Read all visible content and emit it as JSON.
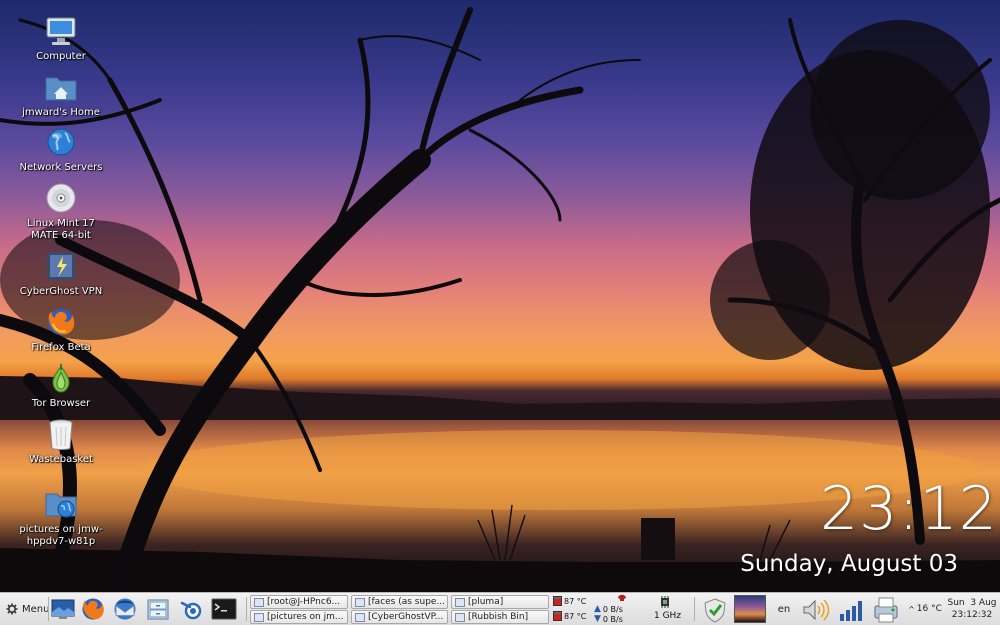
{
  "desktop": {
    "icons": [
      {
        "label": "Computer",
        "icon": "monitor-icon"
      },
      {
        "label": "jmward's Home",
        "icon": "home-folder-icon"
      },
      {
        "label": "Network Servers",
        "icon": "globe-icon"
      },
      {
        "label": "Linux Mint 17 MATE 64-bit",
        "icon": "disc-icon"
      },
      {
        "label": "CyberGhost VPN",
        "icon": "cyberghost-icon"
      },
      {
        "label": "Firefox Beta",
        "icon": "firefox-icon"
      },
      {
        "label": "Tor Browser",
        "icon": "onion-icon"
      },
      {
        "label": "Wastebasket",
        "icon": "trash-icon"
      },
      {
        "label": "pictures on jmw-hppdv7-w81p",
        "icon": "network-folder-icon"
      }
    ]
  },
  "clock": {
    "time": "23:12",
    "date": "Sunday, August 03"
  },
  "panel": {
    "menu_label": "Menu",
    "launchers": [
      {
        "name": "show-desktop",
        "icon": "desktop-icon"
      },
      {
        "name": "firefox",
        "icon": "firefox-icon"
      },
      {
        "name": "thunderbird",
        "icon": "thunderbird-icon"
      },
      {
        "name": "file-manager",
        "icon": "file-cabinet-icon"
      },
      {
        "name": "blender",
        "icon": "blender-icon"
      },
      {
        "name": "terminal",
        "icon": "terminal-icon"
      }
    ],
    "tasks": [
      {
        "label": "[root@J-HPnc6..."
      },
      {
        "label": "[pictures on jm..."
      },
      {
        "label": "[faces (as supe..."
      },
      {
        "label": "[CyberGhostVP..."
      },
      {
        "label": "[pluma]"
      },
      {
        "label": "[Rubbish Bin]"
      }
    ],
    "temp1": "87 °C",
    "temp2": "87 °C",
    "net_up": "0 B/s",
    "net_down": "0 B/s",
    "cpu_freq": "1 GHz",
    "keyboard_layout": "en",
    "weather_temp": "16 °C",
    "clock_date": "Sun  3 Aug",
    "clock_time": "23:12:32"
  }
}
